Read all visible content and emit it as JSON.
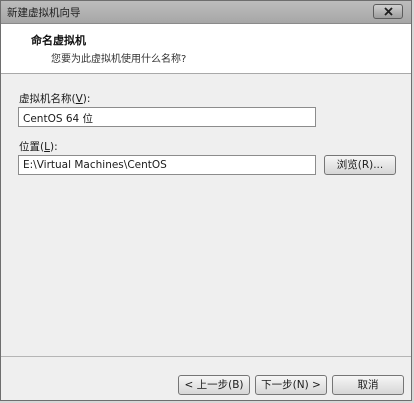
{
  "window": {
    "title": "新建虚拟机向导"
  },
  "header": {
    "title": "命名虚拟机",
    "subtitle": "您要为此虚拟机使用什么名称?"
  },
  "name_field": {
    "label_text": "虚拟机名称(",
    "label_accel": "V",
    "label_end": "):",
    "value": "CentOS 64 位"
  },
  "location_field": {
    "label_text": "位置(",
    "label_accel": "L",
    "label_end": "):",
    "value": "E:\\Virtual Machines\\CentOS"
  },
  "browse_button": {
    "label": "浏览(R)..."
  },
  "footer": {
    "back_label": "< 上一步(B)",
    "next_label": "下一步(N) >",
    "cancel_label": "取消"
  },
  "icons": {
    "close": "close-icon"
  }
}
